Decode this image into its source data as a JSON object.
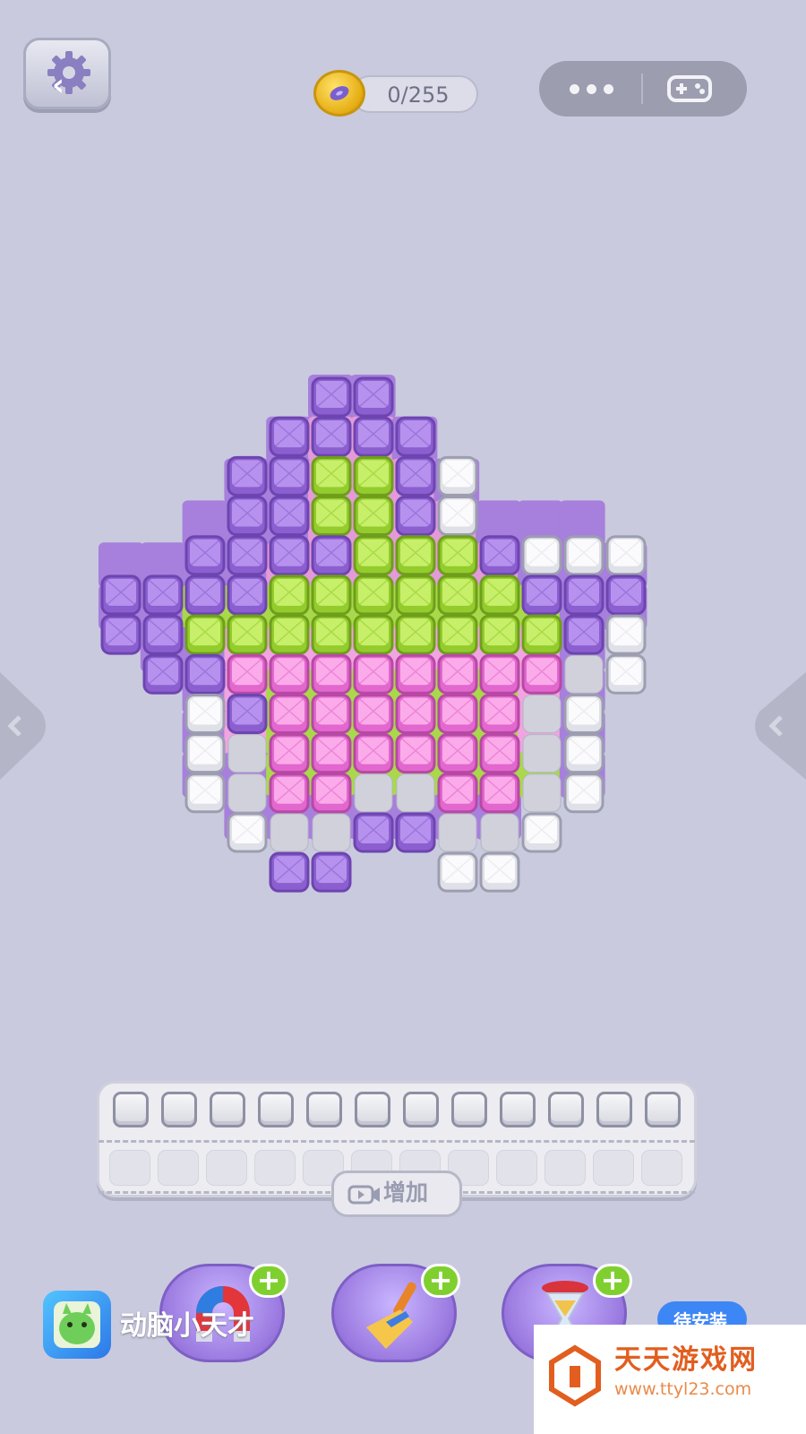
{
  "header": {
    "coin_count": "0/255",
    "back_glyph": "‹",
    "more_icon": "more-dots-icon",
    "game_icon": "gamepad-icon"
  },
  "colors": {
    "background": "#c9cade",
    "purple": "#9b6fd6",
    "green": "#9fd33a",
    "pink": "#ea72d1",
    "white_tile": "#efeff3",
    "accent_blue": "#3d86f5",
    "plus_green": "#7fd02f"
  },
  "board": {
    "rows": 11,
    "cols": 13,
    "cell_colors": [
      [
        "",
        "",
        "",
        "",
        "",
        "P",
        "P",
        "",
        "",
        "",
        "",
        "",
        ""
      ],
      [
        "",
        "",
        "",
        "",
        "P",
        "L",
        "L",
        "P",
        "",
        "",
        "",
        "",
        ""
      ],
      [
        "",
        "",
        "",
        "P",
        "P",
        "L",
        "L",
        "L",
        "P",
        "",
        "",
        "",
        ""
      ],
      [
        "",
        "",
        "P",
        "P",
        "P",
        "L",
        "L",
        "L",
        "L",
        "P",
        "P",
        "P",
        ""
      ],
      [
        "P",
        "P",
        "P",
        "P",
        "L",
        "L",
        "L",
        "L",
        "L",
        "L",
        "P",
        "P",
        "P"
      ],
      [
        "P",
        "P",
        "G",
        "G",
        "G",
        "G",
        "G",
        "G",
        "G",
        "G",
        "G",
        "P",
        "P"
      ],
      [
        "",
        "P",
        "P",
        "K",
        "K",
        "K",
        "K",
        "K",
        "K",
        "K",
        "K",
        "P",
        ""
      ],
      [
        "",
        "",
        "P",
        "K",
        "G",
        "G",
        "G",
        "G",
        "G",
        "G",
        "K",
        "P",
        ""
      ],
      [
        "",
        "",
        "P",
        "K",
        "G",
        "G",
        "G",
        "G",
        "G",
        "G",
        "K",
        "P",
        ""
      ],
      [
        "",
        "",
        "P",
        "P",
        "G",
        "G",
        "G",
        "G",
        "G",
        "G",
        "G",
        "P",
        ""
      ],
      [
        "",
        "",
        "",
        "P",
        "P",
        "P",
        "P",
        "P",
        "P",
        "P",
        "",
        "",
        ""
      ]
    ],
    "tiles": [
      [
        "",
        "",
        "",
        "",
        "",
        "P",
        "P",
        "",
        "",
        "",
        "",
        "",
        ""
      ],
      [
        "",
        "",
        "",
        "",
        "P",
        "P",
        "P",
        "P",
        "",
        "",
        "",
        "",
        ""
      ],
      [
        "",
        "",
        "",
        "P",
        "P",
        "G",
        "G",
        "P",
        "W",
        "",
        "",
        "",
        ""
      ],
      [
        "",
        "",
        "",
        "P",
        "P",
        "G",
        "G",
        "P",
        "W",
        "",
        "",
        "",
        ""
      ],
      [
        "",
        "",
        "P",
        "P",
        "P",
        "P",
        "G",
        "G",
        "G",
        "P",
        "W",
        "W",
        "W"
      ],
      [
        "P",
        "P",
        "P",
        "P",
        "G",
        "G",
        "G",
        "G",
        "G",
        "G",
        "P",
        "P",
        "P"
      ],
      [
        "P",
        "P",
        "G",
        "G",
        "G",
        "G",
        "G",
        "G",
        "G",
        "G",
        "G",
        "P",
        "W"
      ],
      [
        "",
        "P",
        "P",
        "K",
        "K",
        "K",
        "K",
        "K",
        "K",
        "K",
        "K",
        "E",
        "W"
      ],
      [
        "",
        "",
        "W",
        "P",
        "K",
        "K",
        "K",
        "K",
        "K",
        "K",
        "E",
        "W",
        ""
      ],
      [
        "",
        "",
        "W",
        "E",
        "K",
        "K",
        "K",
        "K",
        "K",
        "K",
        "E",
        "W",
        ""
      ],
      [
        "",
        "",
        "W",
        "E",
        "K",
        "K",
        "E",
        "E",
        "K",
        "K",
        "E",
        "W",
        ""
      ],
      [
        "",
        "",
        "",
        "W",
        "E",
        "E",
        "P",
        "P",
        "E",
        "E",
        "W",
        "",
        ""
      ],
      [
        "",
        "",
        "",
        "",
        "P",
        "P",
        "",
        "",
        "W",
        "W",
        "",
        "",
        ""
      ]
    ]
  },
  "tray": {
    "filled_slots": 12,
    "empty_slots": 12,
    "add_label": "增加",
    "add_icon": "video-icon"
  },
  "boosters": [
    {
      "name": "magnet",
      "icon": "magnet-icon",
      "plus": "+"
    },
    {
      "name": "broom",
      "icon": "broom-icon",
      "plus": "+"
    },
    {
      "name": "hourglass",
      "icon": "hourglass-icon",
      "plus": "+"
    }
  ],
  "ad": {
    "app_name": "动脑小天才",
    "install_label": "待安装"
  },
  "watermark": {
    "title": "天天游戏网",
    "url": "www.ttyl23.com"
  }
}
